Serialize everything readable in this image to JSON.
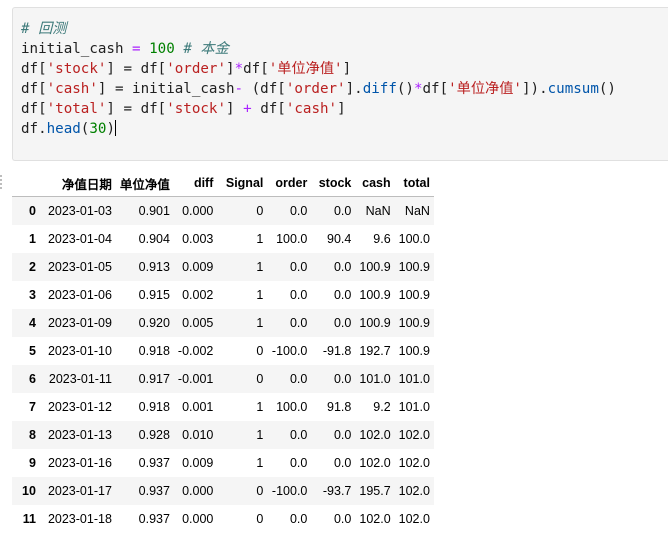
{
  "code": {
    "line1": "# 回测",
    "line2_a": "initial_cash",
    "line2_b": "=",
    "line2_c": "100",
    "line2_d": "# 本金",
    "line3_a": "df[",
    "line3_b": "'stock'",
    "line3_c": "] = df[",
    "line3_d": "'order'",
    "line3_e": "]",
    "line3_f": "*",
    "line3_g": "df[",
    "line3_h": "'单位净值'",
    "line3_i": "]",
    "line4_a": "df[",
    "line4_b": "'cash'",
    "line4_c": "] = initial_cash",
    "line4_d": "-",
    "line4_e": " (df[",
    "line4_f": "'order'",
    "line4_g": "].",
    "line4_h": "diff",
    "line4_i": "()",
    "line4_j": "*",
    "line4_k": "df[",
    "line4_l": "'单位净值'",
    "line4_m": "]).",
    "line4_n": "cumsum",
    "line4_o": "()",
    "line5_a": "df[",
    "line5_b": "'total'",
    "line5_c": "] = df[",
    "line5_d": "'stock'",
    "line5_e": "] ",
    "line5_f": "+",
    "line5_g": " df[",
    "line5_h": "'cash'",
    "line5_i": "]",
    "line6_a": "df.",
    "line6_b": "head",
    "line6_c": "(",
    "line6_d": "30",
    "line6_e": ")"
  },
  "table": {
    "columns": [
      "",
      "净值日期",
      "单位净值",
      "diff",
      "Signal",
      "order",
      "stock",
      "cash",
      "total"
    ],
    "rows": [
      [
        "0",
        "2023-01-03",
        "0.901",
        "0.000",
        "0",
        "0.0",
        "0.0",
        "NaN",
        "NaN"
      ],
      [
        "1",
        "2023-01-04",
        "0.904",
        "0.003",
        "1",
        "100.0",
        "90.4",
        "9.6",
        "100.0"
      ],
      [
        "2",
        "2023-01-05",
        "0.913",
        "0.009",
        "1",
        "0.0",
        "0.0",
        "100.9",
        "100.9"
      ],
      [
        "3",
        "2023-01-06",
        "0.915",
        "0.002",
        "1",
        "0.0",
        "0.0",
        "100.9",
        "100.9"
      ],
      [
        "4",
        "2023-01-09",
        "0.920",
        "0.005",
        "1",
        "0.0",
        "0.0",
        "100.9",
        "100.9"
      ],
      [
        "5",
        "2023-01-10",
        "0.918",
        "-0.002",
        "0",
        "-100.0",
        "-91.8",
        "192.7",
        "100.9"
      ],
      [
        "6",
        "2023-01-11",
        "0.917",
        "-0.001",
        "0",
        "0.0",
        "0.0",
        "101.0",
        "101.0"
      ],
      [
        "7",
        "2023-01-12",
        "0.918",
        "0.001",
        "1",
        "100.0",
        "91.8",
        "9.2",
        "101.0"
      ],
      [
        "8",
        "2023-01-13",
        "0.928",
        "0.010",
        "1",
        "0.0",
        "0.0",
        "102.0",
        "102.0"
      ],
      [
        "9",
        "2023-01-16",
        "0.937",
        "0.009",
        "1",
        "0.0",
        "0.0",
        "102.0",
        "102.0"
      ],
      [
        "10",
        "2023-01-17",
        "0.937",
        "0.000",
        "0",
        "-100.0",
        "-93.7",
        "195.7",
        "102.0"
      ],
      [
        "11",
        "2023-01-18",
        "0.937",
        "0.000",
        "0",
        "0.0",
        "0.0",
        "102.0",
        "102.0"
      ]
    ]
  }
}
